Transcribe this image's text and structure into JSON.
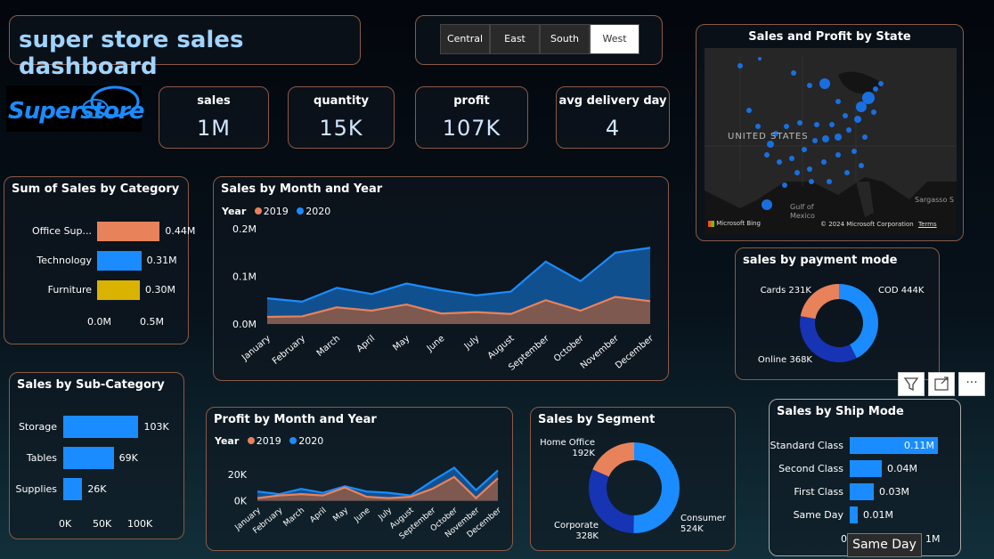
{
  "title": "super store sales dashboard",
  "logo_text": "Superstore",
  "regions": [
    "Central",
    "East",
    "South",
    "West"
  ],
  "selected_region": "West",
  "kpis": [
    {
      "label": "sales",
      "value": "1M"
    },
    {
      "label": "quantity",
      "value": "15K"
    },
    {
      "label": "profit",
      "value": "107K"
    },
    {
      "label": "avg delivery day",
      "value": "4"
    }
  ],
  "map": {
    "title": "Sales and Profit by State",
    "country_label": "UNITED STATES",
    "gulf_label": "Gulf of Mexico",
    "sea_label": "Sargasso S",
    "provider": "Microsoft Bing",
    "copyright": "© 2024 Microsoft Corporation",
    "terms": "Terms"
  },
  "tooltip": "Same Day",
  "colors": {
    "y2019": "#e8825b",
    "y2020": "#1a8cff",
    "area2020": "#135aa3",
    "area2019": "#8a5a48"
  },
  "chart_data": [
    {
      "id": "category",
      "type": "bar",
      "title": "Sum of Sales by Category",
      "categories": [
        "Office Sup...",
        "Technology",
        "Furniture"
      ],
      "values": [
        0.44,
        0.31,
        0.3
      ],
      "labels": [
        "0.44M",
        "0.31M",
        "0.30M"
      ],
      "bar_colors": [
        "#e8825b",
        "#1a8cff",
        "#d9b300"
      ],
      "xticks": [
        "0.0M",
        "0.5M"
      ],
      "xlim": [
        0,
        0.5
      ]
    },
    {
      "id": "sales_month",
      "type": "area",
      "title": "Sales by Month and Year",
      "legend_title": "Year",
      "x": [
        "January",
        "February",
        "March",
        "April",
        "May",
        "June",
        "July",
        "August",
        "September",
        "October",
        "November",
        "December"
      ],
      "series": [
        {
          "name": "2019",
          "values": [
            0.015,
            0.016,
            0.035,
            0.028,
            0.041,
            0.022,
            0.025,
            0.021,
            0.05,
            0.028,
            0.057,
            0.048
          ]
        },
        {
          "name": "2020",
          "values": [
            0.054,
            0.047,
            0.076,
            0.063,
            0.085,
            0.071,
            0.06,
            0.068,
            0.131,
            0.09,
            0.15,
            0.16
          ]
        }
      ],
      "yticks": [
        "0.0M",
        "0.1M",
        "0.2M"
      ],
      "ylim": [
        0,
        0.2
      ]
    },
    {
      "id": "payment",
      "type": "pie",
      "title": "sales by payment mode",
      "categories": [
        "COD",
        "Online",
        "Cards"
      ],
      "values": [
        444,
        368,
        231
      ],
      "labels": [
        "COD 444K",
        "Online 368K",
        "Cards 231K"
      ],
      "slice_colors": [
        "#1a8cff",
        "#1734b5",
        "#e8825b"
      ]
    },
    {
      "id": "subcategory",
      "type": "bar",
      "title": "Sales by Sub-Category",
      "categories": [
        "Storage",
        "Tables",
        "Supplies"
      ],
      "values": [
        103,
        69,
        26
      ],
      "labels": [
        "103K",
        "69K",
        "26K"
      ],
      "xticks": [
        "0K",
        "50K",
        "100K"
      ],
      "xlim": [
        0,
        100
      ]
    },
    {
      "id": "profit_month",
      "type": "area",
      "title": "Profit by Month and Year",
      "legend_title": "Year",
      "x": [
        "January",
        "February",
        "March",
        "April",
        "May",
        "June",
        "July",
        "August",
        "September",
        "October",
        "November",
        "December"
      ],
      "series": [
        {
          "name": "2019",
          "values": [
            2,
            4,
            5,
            4,
            10,
            3,
            2,
            3,
            9,
            18,
            2,
            17
          ]
        },
        {
          "name": "2020",
          "values": [
            7,
            5,
            9,
            6,
            11,
            7,
            6,
            4,
            15,
            25,
            8,
            23
          ]
        }
      ],
      "yticks": [
        "0K",
        "20K"
      ],
      "ylim": [
        -5,
        30
      ]
    },
    {
      "id": "segment",
      "type": "pie",
      "title": "Sales by Segment",
      "categories": [
        "Consumer",
        "Corporate",
        "Home Office"
      ],
      "values": [
        524,
        328,
        192
      ],
      "labels": [
        "Consumer 524K",
        "Corporate 328K",
        "Home Office 192K"
      ],
      "slice_colors": [
        "#1a8cff",
        "#1734b5",
        "#e8825b"
      ]
    },
    {
      "id": "shipmode",
      "type": "bar",
      "title": "Sales by Ship Mode",
      "categories": [
        "Standard Class",
        "Second Class",
        "First Class",
        "Same Day"
      ],
      "values": [
        0.11,
        0.04,
        0.03,
        0.01
      ],
      "labels": [
        "0.11M",
        "0.04M",
        "0.03M",
        "0.01M"
      ],
      "xticks": [
        "0.",
        "1M"
      ],
      "xlim": [
        0,
        0.11
      ]
    }
  ]
}
